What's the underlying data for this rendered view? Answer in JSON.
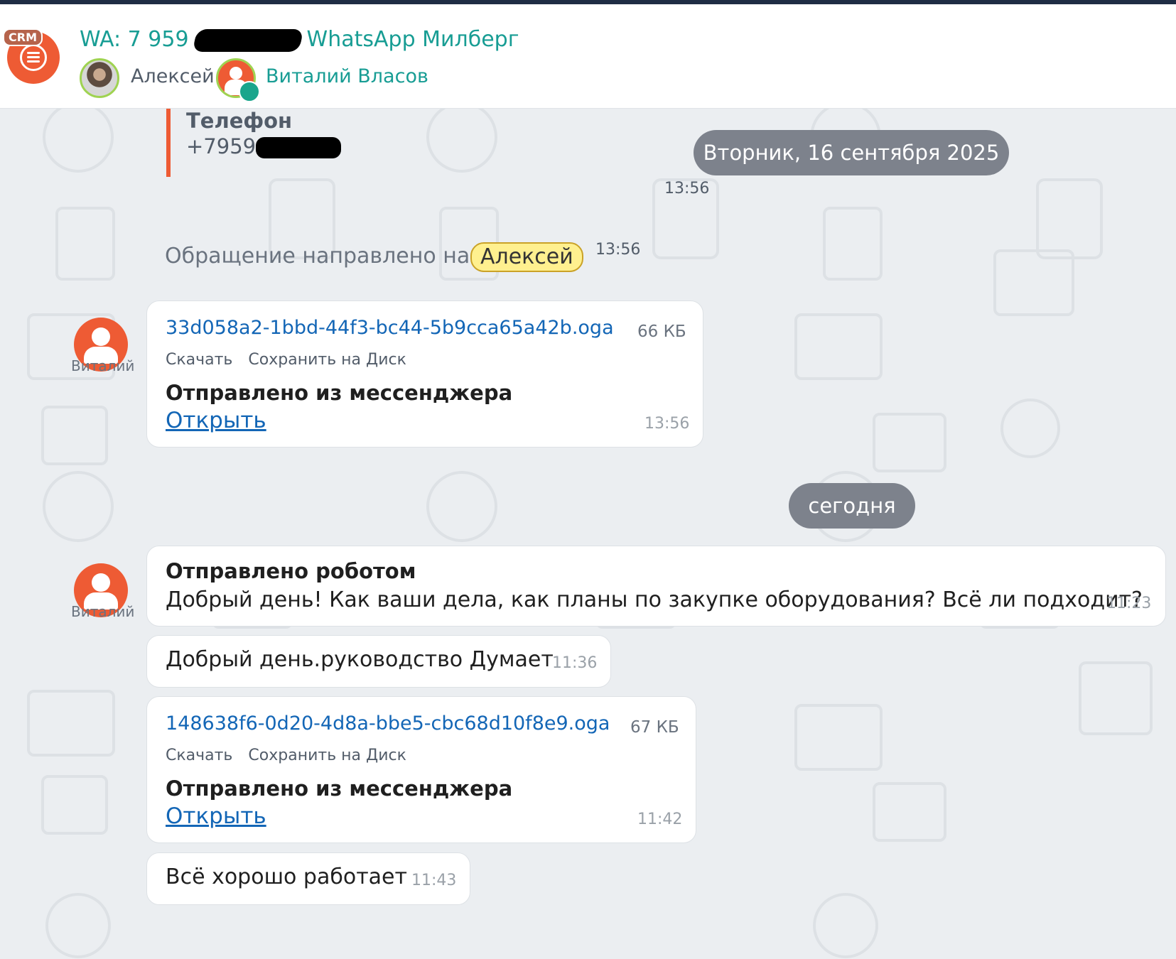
{
  "header": {
    "crm_badge": "CRM",
    "title_prefix": "WA: 7 959",
    "title_suffix": "WhatsApp Милберг",
    "members": [
      {
        "name": "Алексей"
      },
      {
        "name": "Виталий Власов"
      }
    ]
  },
  "quote": {
    "title": "Телефон",
    "value": "+7959"
  },
  "date_pills": [
    "Вторник, 16 сентября 2025",
    "сегодня"
  ],
  "system_message": {
    "time_top": "13:56",
    "text": "Обращение направлено на",
    "tag": "Алексей",
    "time": "13:56"
  },
  "messages": [
    {
      "author": "Виталий",
      "file_name": "33d058a2-1bbd-44f3-bc44-5b9cca65a42b.oga",
      "file_size": "66 КБ",
      "download": "Скачать",
      "save": "Сохранить на Диск",
      "title": "Отправлено из мессенджера",
      "open": "Открыть",
      "time": "13:56"
    },
    {
      "author": "Виталий",
      "title": "Отправлено роботом",
      "text": "Добрый день! Как ваши дела, как планы по закупке оборудования? Всё ли подходит?",
      "time": "11:23"
    },
    {
      "text": "Добрый день.руководство Думает",
      "time": "11:36"
    },
    {
      "file_name": "148638f6-0d20-4d8a-bbe5-cbc68d10f8e9.oga",
      "file_size": "67 КБ",
      "download": "Скачать",
      "save": "Сохранить на Диск",
      "title": "Отправлено из мессенджера",
      "open": "Открыть",
      "time": "11:42"
    },
    {
      "text": "Всё хорошо работает",
      "time": "11:43"
    }
  ],
  "colors": {
    "accent": "#189d94",
    "avatar": "#ee5b34",
    "pill": "#7d828c",
    "link": "#1366b6",
    "tag": "#fff08f"
  }
}
